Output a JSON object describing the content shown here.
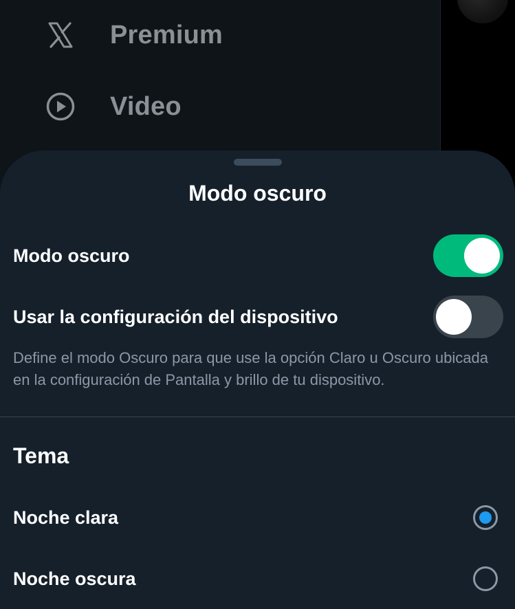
{
  "drawer": {
    "items": [
      {
        "label": "Premium",
        "icon": "x-logo-icon"
      },
      {
        "label": "Video",
        "icon": "play-circle-icon"
      }
    ]
  },
  "sheet": {
    "title": "Modo oscuro",
    "dark_mode": {
      "label": "Modo oscuro",
      "enabled": true
    },
    "use_device": {
      "label": "Usar la configuración del dispositivo",
      "enabled": false
    },
    "description": "Define el modo Oscuro para que use la opción Claro u Oscuro ubicada en la configuración de Pantalla y brillo de tu dispositivo.",
    "theme": {
      "title": "Tema",
      "options": [
        {
          "label": "Noche clara",
          "selected": true
        },
        {
          "label": "Noche oscura",
          "selected": false
        }
      ]
    }
  },
  "colors": {
    "toggle_on": "#00ba7c",
    "radio_accent": "#1d9bf0",
    "sheet_bg": "#15202b"
  }
}
